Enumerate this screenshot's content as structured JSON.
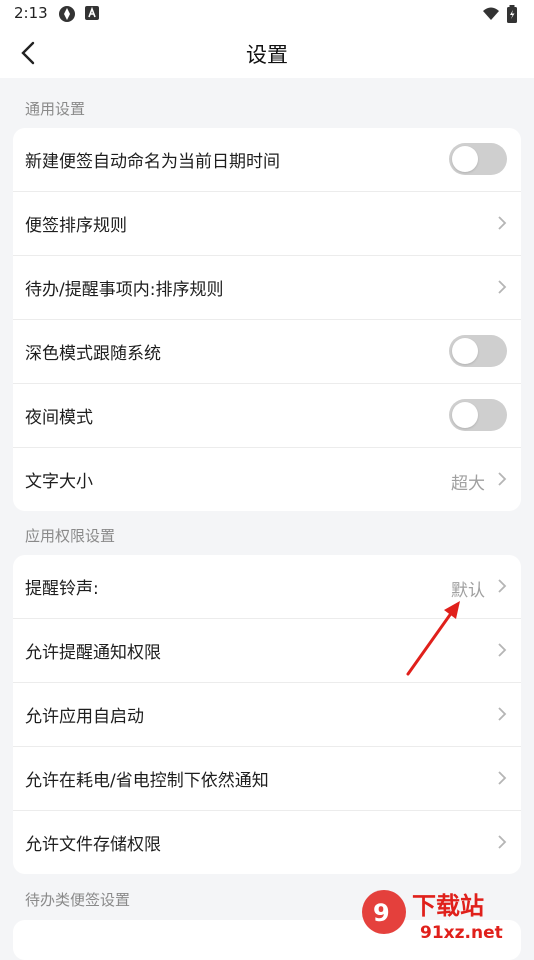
{
  "status_bar": {
    "time": "2:13",
    "icons": [
      "app-icon",
      "a-badge-icon",
      "wifi-icon",
      "battery-icon"
    ]
  },
  "header": {
    "title": "设置"
  },
  "sections": [
    {
      "label": "通用设置",
      "items": [
        {
          "label": "新建便签自动命名为当前日期时间",
          "type": "toggle",
          "on": false
        },
        {
          "label": "便签排序规则",
          "type": "chevron"
        },
        {
          "label": "待办/提醒事项内:排序规则",
          "type": "chevron"
        },
        {
          "label": "深色模式跟随系统",
          "type": "toggle",
          "on": false
        },
        {
          "label": "夜间模式",
          "type": "toggle",
          "on": false
        },
        {
          "label": "文字大小",
          "type": "chevron",
          "value": "超大"
        }
      ]
    },
    {
      "label": "应用权限设置",
      "items": [
        {
          "label": "提醒铃声:",
          "type": "chevron",
          "value": "默认"
        },
        {
          "label": "允许提醒通知权限",
          "type": "chevron"
        },
        {
          "label": "允许应用自启动",
          "type": "chevron"
        },
        {
          "label": "允许在耗电/省电控制下依然通知",
          "type": "chevron"
        },
        {
          "label": "允许文件存储权限",
          "type": "chevron"
        }
      ]
    },
    {
      "label": "待办类便签设置",
      "items": []
    }
  ],
  "colors": {
    "background": "#f4f5f7",
    "card": "#ffffff",
    "toggle_off": "#cfcfcf",
    "annotation_arrow": "#e0201b"
  },
  "watermark": {
    "logo_text": "下载站",
    "url_text": "91xz.net"
  }
}
